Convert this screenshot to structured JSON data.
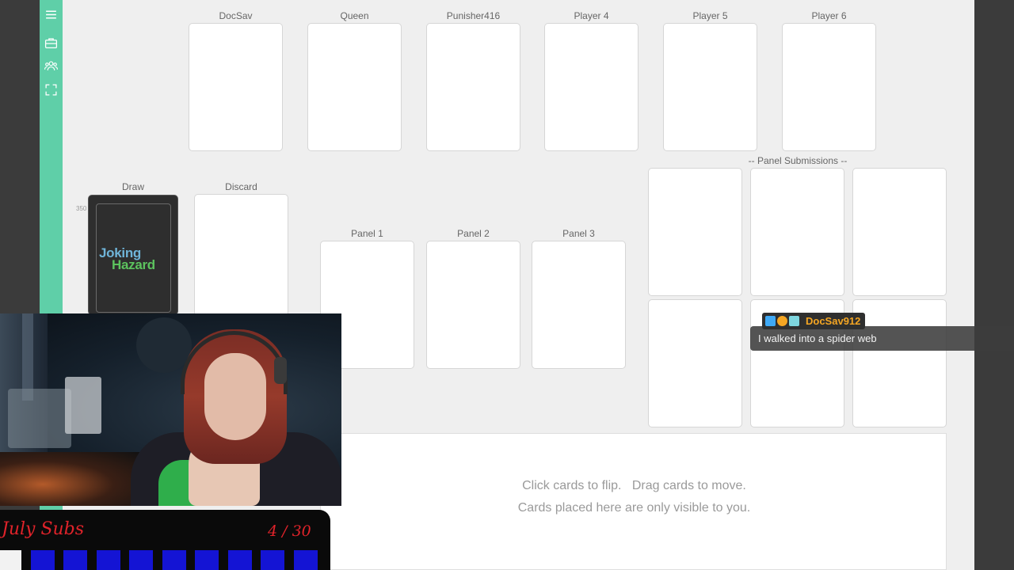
{
  "players": [
    {
      "name": "DocSav"
    },
    {
      "name": "Queen"
    },
    {
      "name": "Punisher416"
    },
    {
      "name": "Player 4"
    },
    {
      "name": "Player 5"
    },
    {
      "name": "Player 6"
    }
  ],
  "piles": {
    "draw_label": "Draw",
    "discard_label": "Discard",
    "deck_count": "350",
    "deck_logo_line1": "Joking",
    "deck_logo_line2": "Hazard"
  },
  "panels": [
    "Panel 1",
    "Panel 2",
    "Panel 3"
  ],
  "submissions_label": "-- Panel Submissions --",
  "hand": {
    "line1": "Click cards to flip.   Drag cards to move.",
    "line2": "Cards placed here are only visible to you."
  },
  "sidebar": {
    "icons": [
      "menu-icon",
      "briefcase-icon",
      "users-icon",
      "fullscreen-icon"
    ]
  },
  "overlay": {
    "subs_title": "July Subs",
    "subs_count": "4 / 30",
    "subs_progress": 0.13,
    "chat_user": "DocSav912",
    "chat_message": "I walked into a spider web",
    "chat_badges": [
      "prime-badge",
      "bits-badge",
      "sub-badge"
    ]
  },
  "colors": {
    "sidebar": "#5fcfa8",
    "background": "#efefef",
    "deck_logo_blue": "#6fb4d8",
    "deck_logo_green": "#5cc35e",
    "subs_red": "#e0232a",
    "subs_blue": "#1414d4",
    "chat_user": "#f5a623"
  }
}
